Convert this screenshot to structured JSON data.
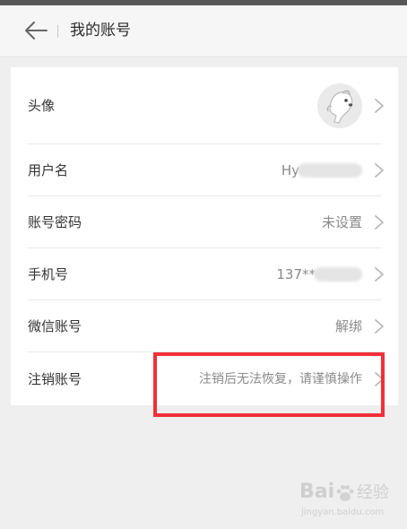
{
  "header": {
    "title": "我的账号"
  },
  "rows": {
    "avatar": {
      "label": "头像"
    },
    "username": {
      "label": "用户名",
      "value": "Hy"
    },
    "password": {
      "label": "账号密码",
      "value": "未设置"
    },
    "phone": {
      "label": "手机号",
      "value": "137**"
    },
    "wechat": {
      "label": "微信账号",
      "value": "解绑"
    },
    "cancel": {
      "label": "注销账号",
      "value": "注销后无法恢复，请谨慎操作"
    }
  },
  "watermark": {
    "brand_left": "Bai",
    "brand_right": "经验",
    "url": "jingyan.baidu.com"
  },
  "colors": {
    "highlight": "#f2303a",
    "background": "#efefef"
  }
}
